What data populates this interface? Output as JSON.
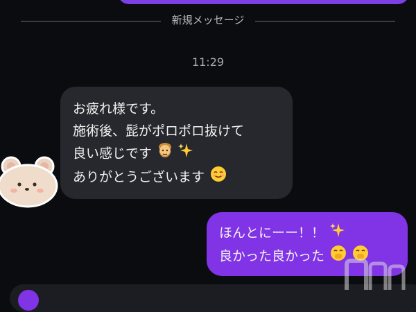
{
  "divider": {
    "label": "新規メッセージ"
  },
  "timestamp": "11:29",
  "incoming_message": {
    "lines": [
      {
        "text": "お疲れ様です。"
      },
      {
        "text": "施術後、髭がポロポロ抜けて"
      },
      {
        "text": "良い感じです",
        "emoji": [
          "man-face-emoji",
          "sparkles-emoji"
        ]
      },
      {
        "text": "ありがとうございます",
        "emoji": [
          "smiling-face-emoji"
        ]
      }
    ]
  },
  "outgoing_message": {
    "lines": [
      {
        "text": "ほんとにーー！！",
        "emoji": [
          "sparkles-emoji"
        ]
      },
      {
        "text": "良かった良かった",
        "emoji": [
          "hand-over-mouth-emoji",
          "hand-over-mouth-emoji"
        ]
      }
    ]
  },
  "colors": {
    "background": "#0b0c0f",
    "incoming_bubble": "#26282d",
    "outgoing_bubble": "#8133e6"
  },
  "avatar": {
    "icon": "bear-sticker-icon"
  },
  "watermark": {
    "icon": "site-logo-watermark"
  }
}
